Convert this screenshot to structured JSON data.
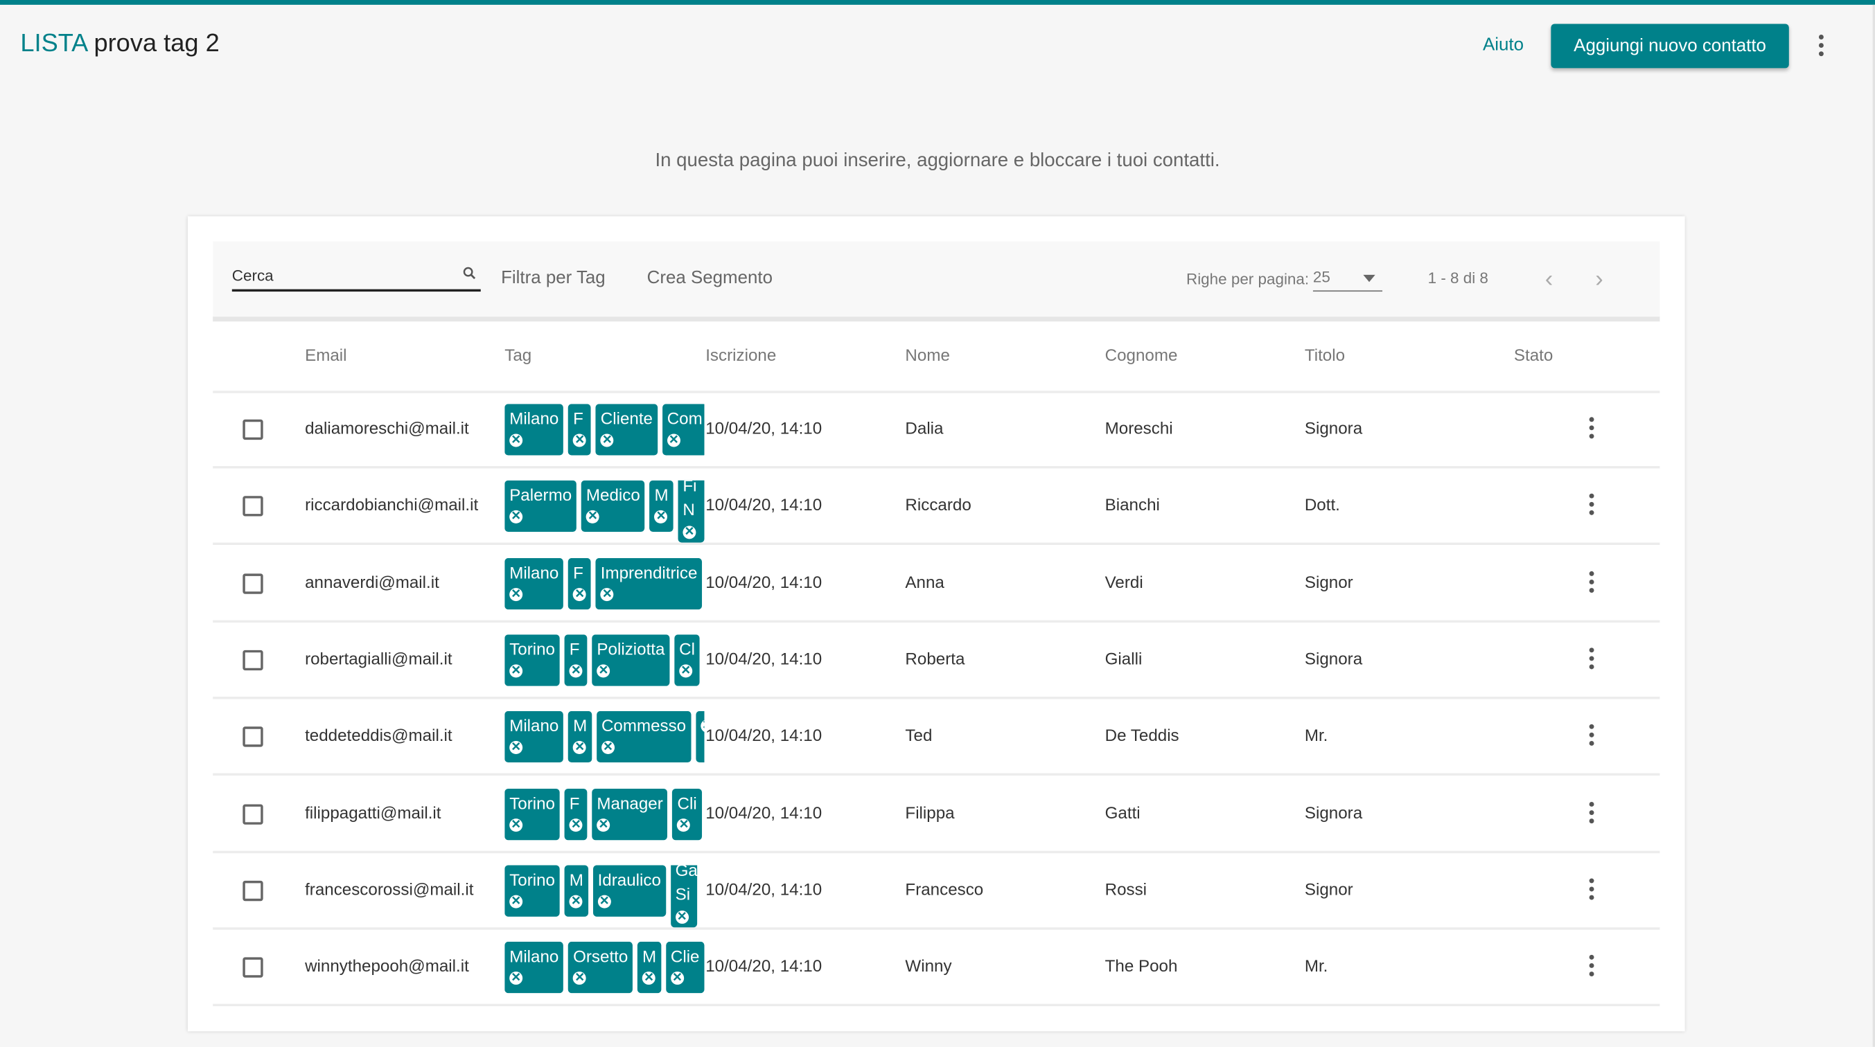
{
  "header": {
    "brand": "LISTA",
    "title": "prova tag 2",
    "help": "Aiuto",
    "add_button": "Aggiungi nuovo contatto"
  },
  "subtitle": "In questa pagina puoi inserire, aggiornare e bloccare i tuoi contatti.",
  "toolbar": {
    "search_placeholder": "Cerca",
    "filter": "Filtra per Tag",
    "segment": "Crea Segmento",
    "rows_per_page_label": "Righe per pagina:",
    "rows_per_page": "25",
    "range": "1 - 8 di 8"
  },
  "columns": [
    "Email",
    "Tag",
    "Iscrizione",
    "Nome",
    "Cognome",
    "Titolo",
    "Stato"
  ],
  "colors": {
    "accent": "#00818a",
    "background": "#f6f6f6"
  },
  "rows": [
    {
      "email": "daliamoreschi@mail.it",
      "tags": [
        "Milano",
        "F",
        "Cliente",
        "Com"
      ],
      "iscrizione": "10/04/20, 14:10",
      "nome": "Dalia",
      "cognome": "Moreschi",
      "titolo": "Signora"
    },
    {
      "email": "riccardobianchi@mail.it",
      "tags": [
        "Palermo",
        "Medico",
        "M",
        "Fi N"
      ],
      "iscrizione": "10/04/20, 14:10",
      "nome": "Riccardo",
      "cognome": "Bianchi",
      "titolo": "Dott."
    },
    {
      "email": "annaverdi@mail.it",
      "tags": [
        "Milano",
        "F",
        "Imprenditrice"
      ],
      "iscrizione": "10/04/20, 14:10",
      "nome": "Anna",
      "cognome": "Verdi",
      "titolo": "Signor"
    },
    {
      "email": "robertagialli@mail.it",
      "tags": [
        "Torino",
        "F",
        "Poliziotta",
        "Cl"
      ],
      "iscrizione": "10/04/20, 14:10",
      "nome": "Roberta",
      "cognome": "Gialli",
      "titolo": "Signora"
    },
    {
      "email": "teddeteddis@mail.it",
      "tags": [
        "Milano",
        "M",
        "Commesso",
        ""
      ],
      "iscrizione": "10/04/20, 14:10",
      "nome": "Ted",
      "cognome": "De Teddis",
      "titolo": "Mr."
    },
    {
      "email": "filippagatti@mail.it",
      "tags": [
        "Torino",
        "F",
        "Manager",
        "Cli"
      ],
      "iscrizione": "10/04/20, 14:10",
      "nome": "Filippa",
      "cognome": "Gatti",
      "titolo": "Signora"
    },
    {
      "email": "francescorossi@mail.it",
      "tags": [
        "Torino",
        "M",
        "Idraulico",
        "Ga Si"
      ],
      "iscrizione": "10/04/20, 14:10",
      "nome": "Francesco",
      "cognome": "Rossi",
      "titolo": "Signor"
    },
    {
      "email": "winnythepooh@mail.it",
      "tags": [
        "Milano",
        "Orsetto",
        "M",
        "Clie"
      ],
      "iscrizione": "10/04/20, 14:10",
      "nome": "Winny",
      "cognome": "The Pooh",
      "titolo": "Mr."
    }
  ]
}
